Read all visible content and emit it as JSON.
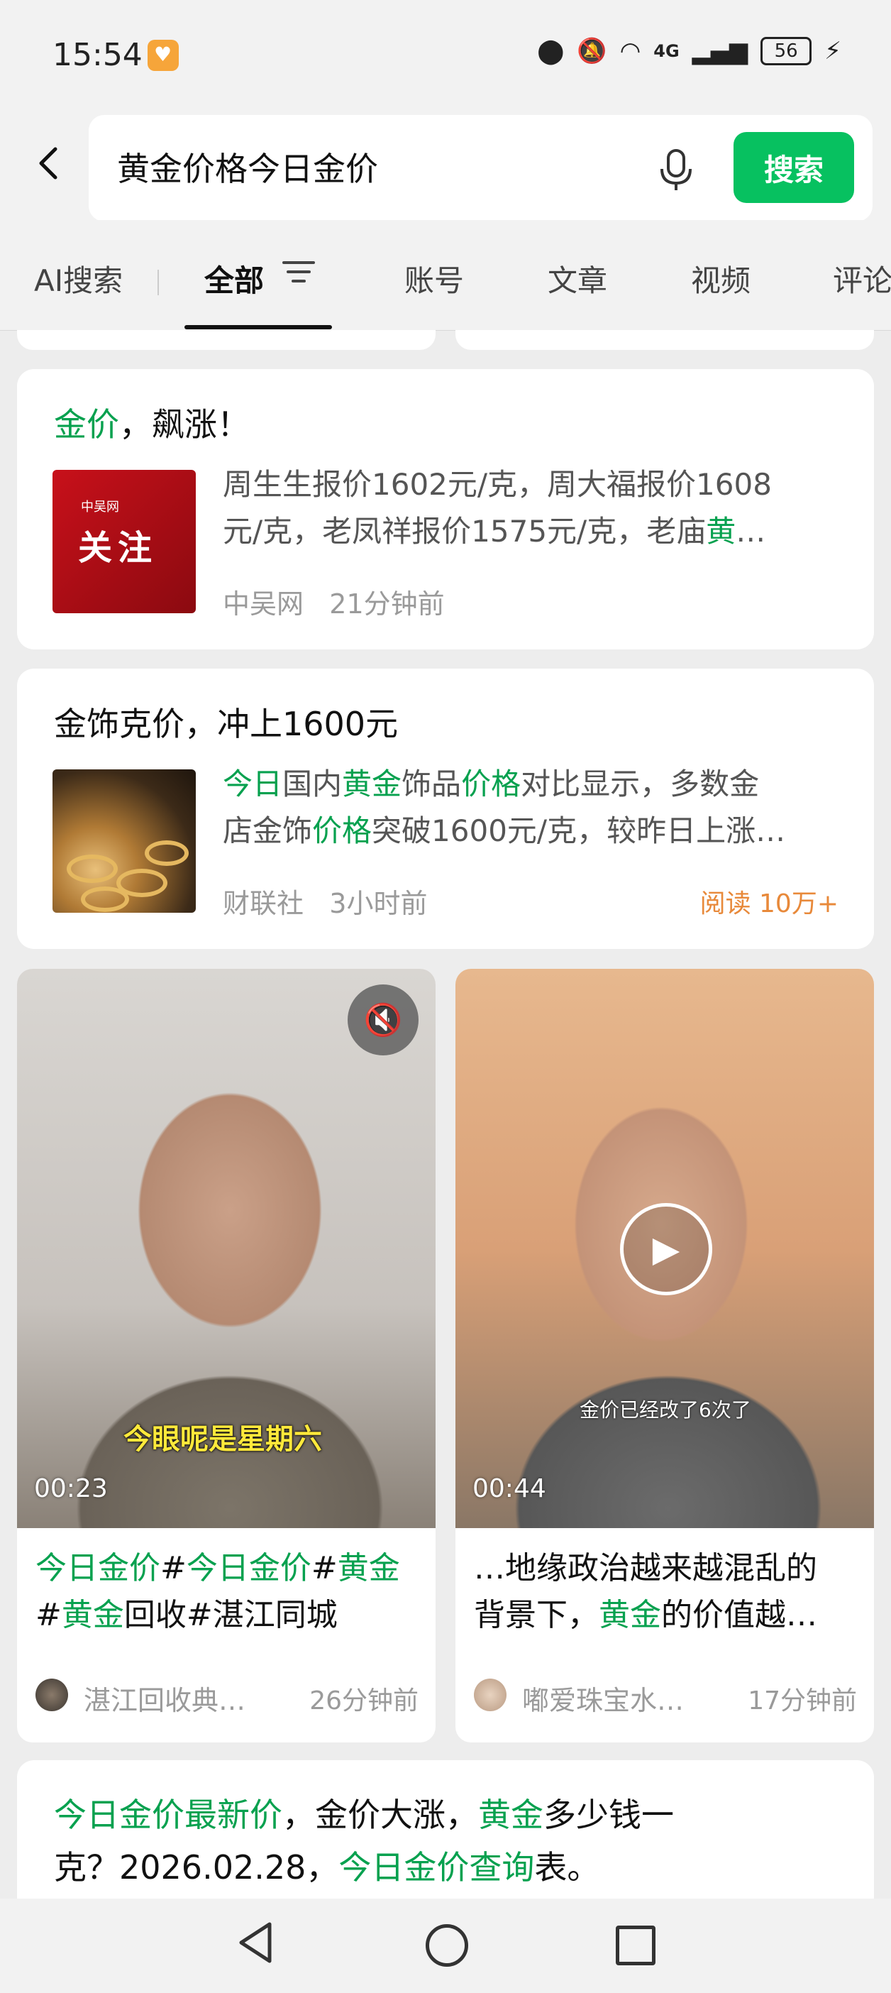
{
  "status": {
    "time": "15:54",
    "battery": "56",
    "network": "4G"
  },
  "search": {
    "query": "黄金价格今日金价",
    "button": "搜索"
  },
  "tabs": [
    {
      "label": "AI搜索"
    },
    {
      "label": "全部"
    },
    {
      "label": "账号"
    },
    {
      "label": "文章"
    },
    {
      "label": "视频"
    },
    {
      "label": "评论"
    }
  ],
  "colors": {
    "accent": "#07c160",
    "highlight": "#07a14f",
    "read_count": "#e8893a"
  },
  "cards": [
    {
      "title_hl": "金价",
      "title_rest": "，飙涨！",
      "thumb_small": "中吴网",
      "thumb_big": "关注",
      "desc_line1": "周生生报价1602元/克，周大福报价1608",
      "desc_line2_pre": "元/克，老凤祥报价1575元/克，老庙",
      "desc_line2_hl": "黄",
      "desc_line2_post": "…",
      "source": "中吴网",
      "time": "21分钟前"
    },
    {
      "title": "金饰克价，冲上1600元",
      "d1": "今日",
      "d2": "国内",
      "d3": "黄金",
      "d4": "饰品",
      "d5": "价格",
      "d6": "对比显示，多数金",
      "d7": "店金饰",
      "d8": "价格",
      "d9": "突破1600元/克，较昨日上涨…",
      "source": "财联社",
      "time": "3小时前",
      "reads": "阅读 10万+"
    }
  ],
  "videos": [
    {
      "duration": "00:23",
      "subtitle": "今眼呢是星期六",
      "t1": "今日金价",
      "t2": "#",
      "t3": "今日金价",
      "t4": "#",
      "t5": "黄金",
      "t6": "#",
      "t7": "黄金",
      "t8": "回收#湛江同城",
      "author": "湛江回收典…",
      "time": "26分钟前"
    },
    {
      "duration": "00:44",
      "subtitle": "金价已经改了6次了",
      "t1": "…地缘政治越来越混乱的",
      "t2": "背景下，",
      "t3": "黄金",
      "t4": "的价值越…",
      "author": "嘟爱珠宝水…",
      "time": "17分钟前"
    }
  ],
  "bottom_card": {
    "a": "今日金价最新价",
    "b": "，金价大涨，",
    "c": "黄金",
    "d": "多少钱一",
    "e": "克？2026.02.28，",
    "f": "今日金价查询",
    "g": "表。"
  }
}
